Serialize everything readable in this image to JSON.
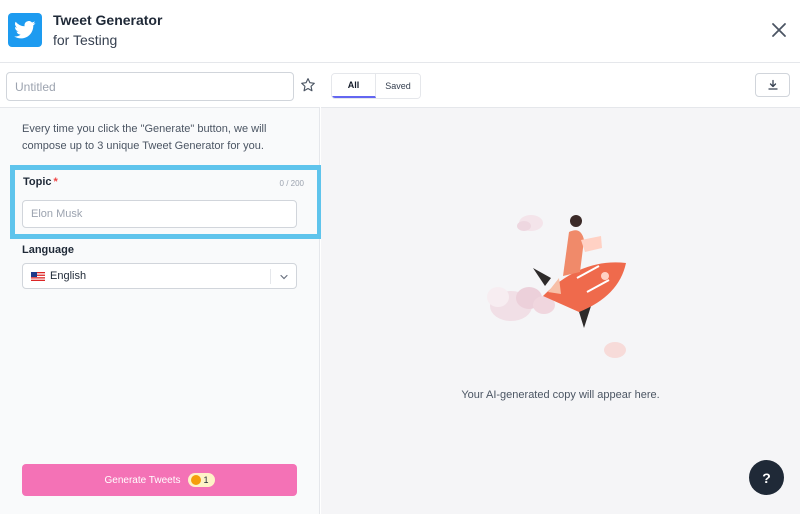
{
  "header": {
    "title": "Tweet Generator",
    "subtitle": "for Testing",
    "logo_icon": "twitter-bird-icon",
    "close_icon": "close-icon"
  },
  "sidebar": {
    "name_placeholder": "Untitled",
    "favorite_icon": "star-icon",
    "description": "Every time you click the \"Generate\" button, we will compose up to 3 unique Tweet Generator for you.",
    "topic": {
      "label": "Topic",
      "required_mark": "*",
      "counter": "0 / 200",
      "placeholder": "Elon Musk"
    },
    "language": {
      "label": "Language",
      "selected": "English",
      "flag_icon": "us-flag-icon"
    },
    "generate": {
      "label": "Generate Tweets",
      "credits": "1"
    }
  },
  "main": {
    "tabs": [
      {
        "label": "All",
        "active": true
      },
      {
        "label": "Saved",
        "active": false
      }
    ],
    "download_icon": "download-icon",
    "empty_message": "Your AI-generated copy will appear here.",
    "help_label": "?"
  },
  "colors": {
    "twitter_blue": "#1d9bf0",
    "highlight_border": "#5fc4ec",
    "generate_button": "#f472b6",
    "tab_accent": "#6366f1",
    "help_button": "#1f2937"
  }
}
